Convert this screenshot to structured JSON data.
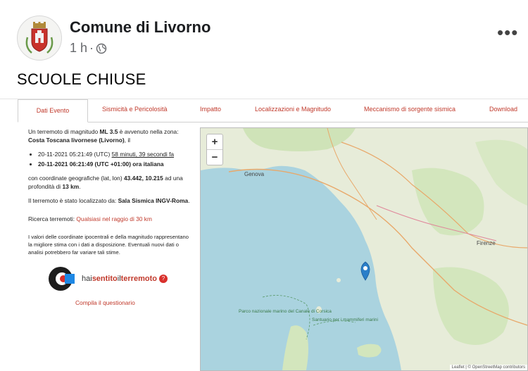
{
  "post": {
    "page_name": "Comune di Livorno",
    "time": "1 h",
    "separator": "·",
    "text": "SCUOLE CHIUSE",
    "more": "•••"
  },
  "tabs": [
    {
      "label": "Dati Evento"
    },
    {
      "label": "Sismicità e Pericolosità"
    },
    {
      "label": "Impatto"
    },
    {
      "label": "Localizzazioni e Magnitudo"
    },
    {
      "label": "Meccanismo di sorgente sismica"
    },
    {
      "label": "Download"
    }
  ],
  "info": {
    "p1_a": "Un terremoto di magnitudo",
    "magnitude": "ML 3.5",
    "p1_b": "è avvenuto nella zona:",
    "zone": "Costa Toscana livornese (Livorno)",
    "p1_c": ", il",
    "utc_time": "20-11-2021 05:21:49 (UTC)",
    "ago": "58 minuti, 39 secondi fa",
    "local_time": "20-11-2021 06:21:49 (UTC +01:00) ora italiana",
    "p2_a": "con coordinate geografiche (lat, lon)",
    "coords": "43.442, 10.215",
    "p2_b": "ad una profondità di",
    "depth": "13 km",
    "p3_a": "Il terremoto è stato localizzato da:",
    "located_by": "Sala Sismica INGV-Roma",
    "search_label": "Ricerca terremoti:",
    "search_link": "Qualsiasi nel raggio di 30 km",
    "disclaimer": "I valori delle coordinate ipocentrali e della magnitudo rappresentano la migliore stima con i dati a disposizione. Eventuali nuovi dati o analisi potrebbero far variare tali stime.",
    "hst_a": "hai",
    "hst_b": "sentito",
    "hst_c": "il",
    "hst_d": "terremoto",
    "hst_badge": "?",
    "compila": "Compila il questionario"
  },
  "map": {
    "zoom_in": "+",
    "zoom_out": "−",
    "city_genova": "Genova",
    "city_firenze": "Firenze",
    "park_label": "Parco nazionale marino del Canale di Corsica",
    "reserve_label": "Santuario per i mammiferi marini",
    "attribution": "Leaflet | © OpenStreetMap contributors"
  },
  "colors": {
    "sea": "#aad3df",
    "land": "#eef0e6",
    "accent": "#c0392b",
    "marker": "#2a7fc9"
  }
}
